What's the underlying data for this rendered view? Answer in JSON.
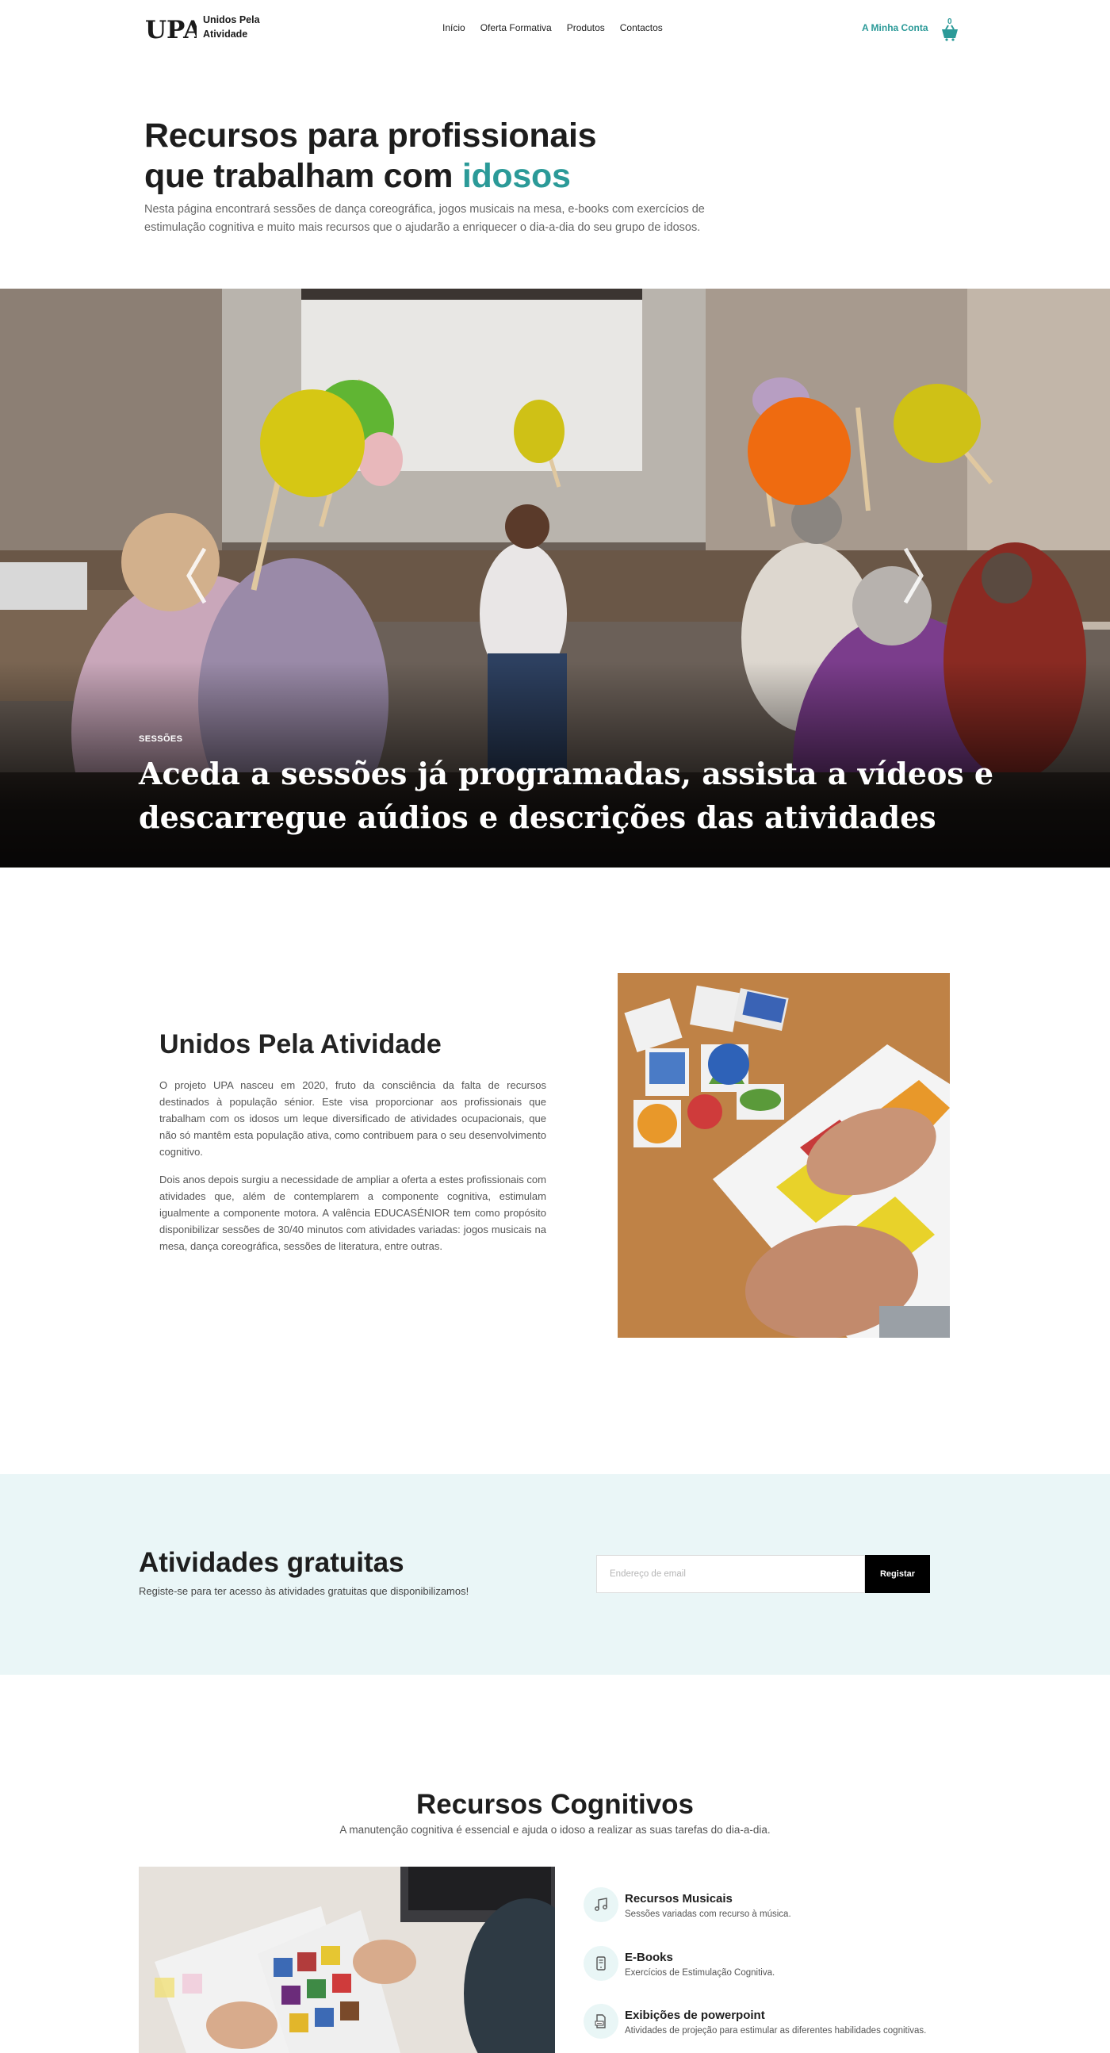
{
  "header": {
    "logo_mark": "UPA",
    "logo_line1": "Unidos Pela",
    "logo_line2": "Atividade",
    "nav": [
      "Início",
      "Oferta Formativa",
      "Produtos",
      "Contactos"
    ],
    "account_label": "A Minha Conta",
    "cart_count": "0",
    "accent_color": "#2b9a98"
  },
  "hero": {
    "title_line1": "Recursos para profissionais",
    "title_line2_prefix": "que trabalham com ",
    "title_accent": "idosos",
    "description": "Nesta página encontrará sessões de dança coreográfica, jogos musicais na mesa, e-books com exercícios de estimulação cognitiva e muito mais recursos que o ajudarão a enriquecer o dia-a-dia do seu grupo de idosos."
  },
  "slider": {
    "tag": "SESSÕES",
    "title": "Aceda a sessões já programadas, assista a vídeos e descarregue aúdios e descrições das atividades",
    "prev_icon": "chevron-left-icon",
    "next_icon": "chevron-right-icon"
  },
  "about": {
    "title": "Unidos Pela Atividade",
    "paragraph1": "O projeto UPA nasceu em 2020, fruto da consciência da falta de recursos destinados à população sénior. Este visa proporcionar aos profissionais que trabalham com os idosos um leque diversificado de atividades ocupacionais, que não só mantêm esta população ativa, como contribuem para o seu desenvolvimento cognitivo.",
    "paragraph2": "Dois anos depois surgiu a necessidade de ampliar a oferta a estes profissionais com atividades que, além de contemplarem a componente cognitiva, estimulam igualmente a componente motora. A valência EDUCASÉNIOR tem como propósito disponibilizar sessões de 30/40 minutos com atividades variadas: jogos musicais na mesa, dança coreográfica, sessões de literatura, entre outras."
  },
  "free": {
    "title": "Atividades gratuitas",
    "subtitle": "Registe-se para ter acesso às atividades gratuitas que disponibilizamos!",
    "email_placeholder": "Endereço de email",
    "button_label": "Registar",
    "background": "#eaf6f7"
  },
  "cognitive": {
    "title": "Recursos Cognitivos",
    "subtitle": "A manutenção cognitiva é essencial e ajuda o idoso a realizar as suas tarefas do dia-a-dia.",
    "features": [
      {
        "title": "Recursos Musicais",
        "desc": "Sessões variadas com recurso à música.",
        "icon": "music-note-icon"
      },
      {
        "title": "E-Books",
        "desc": "Exercícios de Estimulação Cognitiva.",
        "icon": "tablet-icon"
      },
      {
        "title": "Exibições de powerpoint",
        "desc": "Atividades de projeção para estimular as diferentes habilidades cognitivas.",
        "icon": "presentation-file-icon"
      }
    ]
  }
}
